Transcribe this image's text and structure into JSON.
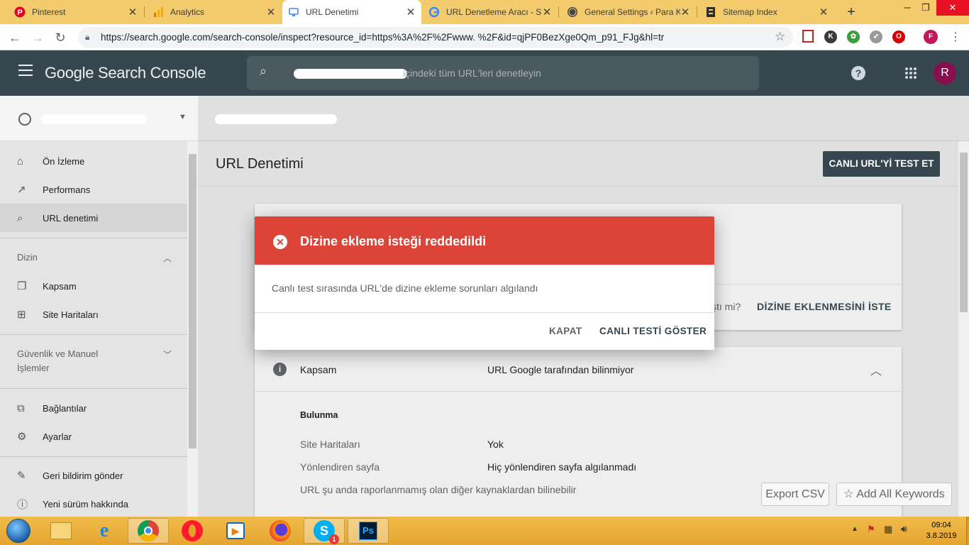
{
  "browser": {
    "tabs": [
      {
        "title": "Pinterest",
        "icon": "pinterest-icon",
        "color": "#e60023",
        "active": false
      },
      {
        "title": "Analytics",
        "icon": "analytics-icon",
        "color": "#f9ab00",
        "active": false
      },
      {
        "title": "URL Denetimi",
        "icon": "search-console-icon",
        "color": "#4285f4",
        "active": true
      },
      {
        "title": "URL Denetleme Aracı - S",
        "icon": "google-icon",
        "color": "#4285f4",
        "active": false
      },
      {
        "title": "General Settings ‹ Para K",
        "icon": "wordpress-icon",
        "color": "#464646",
        "active": false
      },
      {
        "title": "Sitemap Index",
        "icon": "sitemap-icon",
        "color": "#2d2d2d",
        "active": false
      }
    ],
    "new_tab": "+",
    "url": "https://search.google.com/search-console/inspect?resource_id=https%3A%2F%2Fwww.         %2F&id=qjPF0BezXge0Qm_p91_FJg&hl=tr",
    "profile_initial": "F"
  },
  "gsc": {
    "logo": "Google Search Console",
    "search_placeholder": "içindeki tüm URL'leri denetleyin",
    "account_initial": "R",
    "help_glyph": "?"
  },
  "sidebar": {
    "items_top": [
      {
        "label": "Ön İzleme",
        "icon": "home-icon",
        "glyph": "⌂"
      },
      {
        "label": "Performans",
        "icon": "trending-up-icon",
        "glyph": "↗"
      },
      {
        "label": "URL denetimi",
        "icon": "search-icon",
        "glyph": "⌕"
      }
    ],
    "section_index": "Dizin",
    "items_index": [
      {
        "label": "Kapsam",
        "icon": "coverage-icon",
        "glyph": "❐"
      },
      {
        "label": "Site Haritaları",
        "icon": "sitemaps-icon",
        "glyph": "⊞"
      }
    ],
    "section_security": "Güvenlik ve Manuel İşlemler",
    "items_bottom": [
      {
        "label": "Bağlantılar",
        "icon": "links-icon",
        "glyph": "⧉"
      },
      {
        "label": "Ayarlar",
        "icon": "settings-icon",
        "glyph": "⚙"
      }
    ],
    "items_footer": [
      {
        "label": "Geri bildirim gönder",
        "icon": "feedback-icon",
        "glyph": "✎"
      },
      {
        "label": "Yeni sürüm hakkında",
        "icon": "info-icon",
        "glyph": "ⓘ"
      }
    ]
  },
  "main": {
    "title": "URL Denetimi",
    "live_test_button": "CANLI URL'Yİ TEST ET",
    "request_question_fragment": "ştı mi?",
    "request_indexing_button": "DİZİNE EKLENMESİNİ İSTE",
    "coverage": {
      "label": "Kapsam",
      "status": "URL Google tarafından bilinmiyor",
      "discovery_heading": "Bulunma",
      "rows": [
        {
          "label": "Site Haritaları",
          "value": "Yok"
        },
        {
          "label": "Yönlendiren sayfa",
          "value": "Hiç yönlendiren sayfa algılanmadı"
        }
      ],
      "note": "URL şu anda raporlanmamış olan diğer kaynaklardan bilinebilir"
    }
  },
  "dialog": {
    "title": "Dizine ekleme isteği reddedildi",
    "body": "Canlı test sırasında URL'de dizine ekleme sorunları algılandı",
    "close_button": "KAPAT",
    "show_test_button": "CANLI TESTİ GÖSTER",
    "accent_color": "#db4437"
  },
  "floating": {
    "export_csv": "Export CSV",
    "add_keywords": "Add All Keywords",
    "star_glyph": "☆"
  },
  "taskbar": {
    "apps": [
      "start-orb",
      "file-explorer",
      "internet-explorer",
      "chrome",
      "opera",
      "media-player",
      "firefox",
      "skype",
      "photoshop"
    ],
    "skype_badge": "1",
    "photoshop_label": "Ps",
    "time": "09:04",
    "date": "3.8.2019"
  }
}
